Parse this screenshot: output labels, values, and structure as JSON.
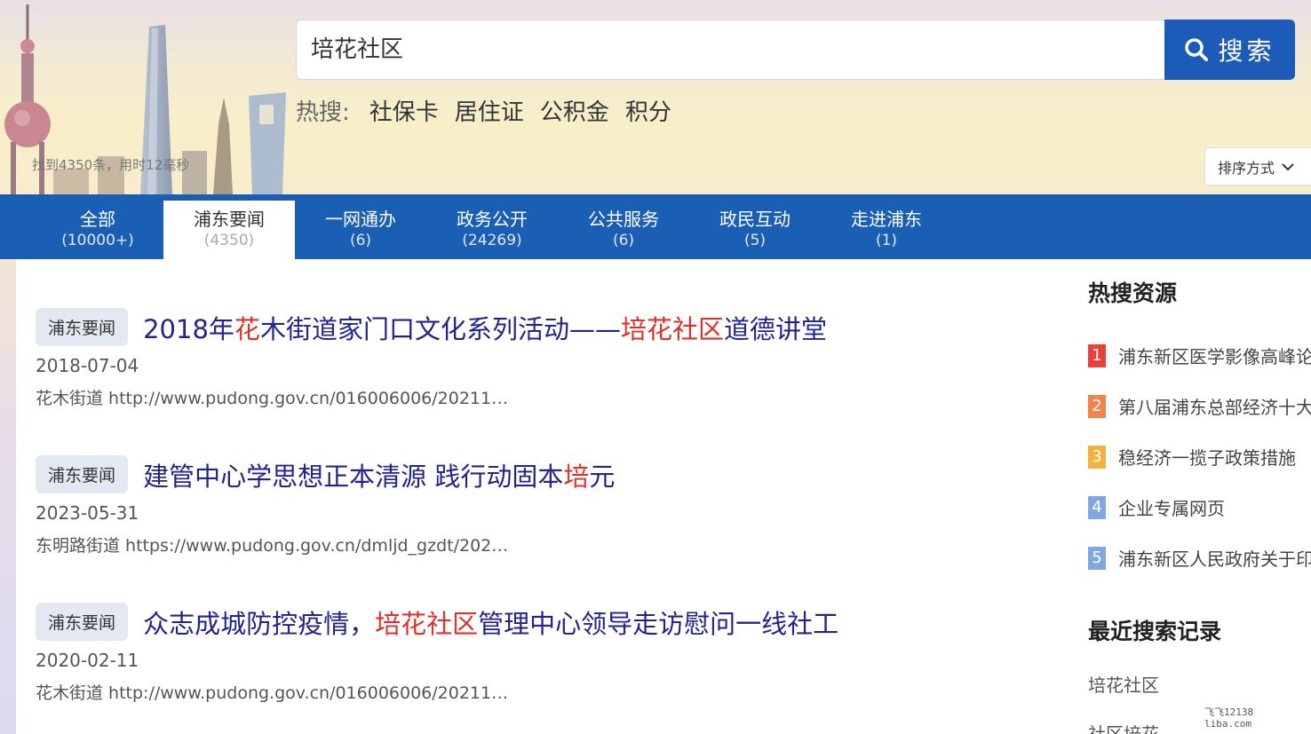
{
  "search": {
    "value": "培花社区",
    "button_label": "搜索",
    "icon": "search-icon"
  },
  "hot_search": {
    "label": "热搜:",
    "items": [
      "社保卡",
      "居住证",
      "公积金",
      "积分"
    ]
  },
  "result_count": "找到4350条，用时12毫秒",
  "sort": {
    "label": "排序方式",
    "icon": "chevron-down-icon"
  },
  "tabs": [
    {
      "label": "全部",
      "count": "(10000+)"
    },
    {
      "label": "浦东要闻",
      "count": "(4350)",
      "active": true
    },
    {
      "label": "一网通办",
      "count": "(6)"
    },
    {
      "label": "政务公开",
      "count": "(24269)"
    },
    {
      "label": "公共服务",
      "count": "(6)"
    },
    {
      "label": "政民互动",
      "count": "(5)"
    },
    {
      "label": "走进浦东",
      "count": "(1)"
    }
  ],
  "results": [
    {
      "tag": "浦东要闻",
      "title_parts": [
        {
          "text": "2018年",
          "hl": false
        },
        {
          "text": "花",
          "hl": true
        },
        {
          "text": "木街道家门口文化系列活动——",
          "hl": false
        },
        {
          "text": "培花社区",
          "hl": true
        },
        {
          "text": "道德讲堂",
          "hl": false
        }
      ],
      "date": "2018-07-04",
      "source": "花木街道 http://www.pudong.gov.cn/016006006/20211…"
    },
    {
      "tag": "浦东要闻",
      "title_parts": [
        {
          "text": "建管中心学思想正本清源 践行动固本",
          "hl": false
        },
        {
          "text": "培",
          "hl": true
        },
        {
          "text": "元",
          "hl": false
        }
      ],
      "date": "2023-05-31",
      "source": "东明路街道 https://www.pudong.gov.cn/dmljd_gzdt/202…"
    },
    {
      "tag": "浦东要闻",
      "title_parts": [
        {
          "text": "众志成城防控疫情，",
          "hl": false
        },
        {
          "text": "培花社区",
          "hl": true
        },
        {
          "text": "管理中心领导走访慰问一线社工",
          "hl": false
        }
      ],
      "date": "2020-02-11",
      "source": "花木街道 http://www.pudong.gov.cn/016006006/20211…"
    }
  ],
  "sidebar": {
    "hot_title": "热搜资源",
    "hot_items": [
      {
        "rank": "1",
        "text": "浦东新区医学影像高峰论坛",
        "color": "#e8413a"
      },
      {
        "rank": "2",
        "text": "第八届浦东总部经济十大",
        "color": "#f2844a"
      },
      {
        "rank": "3",
        "text": "稳经济一揽子政策措施",
        "color": "#f3b23e"
      },
      {
        "rank": "4",
        "text": "企业专属网页",
        "color": "#7fa7e3"
      },
      {
        "rank": "5",
        "text": "浦东新区人民政府关于印",
        "color": "#7fa7e3"
      }
    ],
    "recent_title": "最近搜索记录",
    "recent_items": [
      "培花社区",
      "社区培花"
    ]
  },
  "watermark": [
    "飞飞12138",
    "liba.com"
  ],
  "colors": {
    "brand_blue": "#1a5fb4",
    "highlight_red": "#e0302a",
    "title_blue": "#22238f"
  }
}
